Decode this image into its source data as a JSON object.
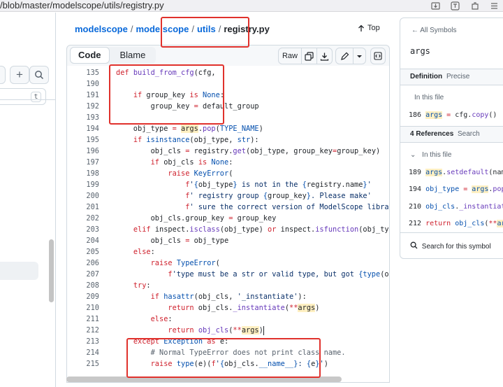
{
  "browser": {
    "url": "/blob/master/modelscope/utils/registry.py",
    "icons": [
      "download-icon",
      "translate-icon",
      "extension-icon",
      "menu-icon"
    ]
  },
  "left": {
    "add_label": "+",
    "kbd_label": "t"
  },
  "breadcrumb": {
    "items": [
      "modelscope",
      "modelscope",
      "utils"
    ],
    "separator": "/",
    "file": "registry.py"
  },
  "top_label": "Top",
  "toolbar": {
    "code_tab": "Code",
    "blame_tab": "Blame",
    "raw_label": "Raw"
  },
  "code_lines": [
    {
      "n": "135",
      "text": "def build_from_cfg(cfg,"
    },
    {
      "n": "190",
      "text": ""
    },
    {
      "n": "191",
      "text": "    if group_key is None:"
    },
    {
      "n": "192",
      "text": "        group_key = default_group"
    },
    {
      "n": "193",
      "text": ""
    },
    {
      "n": "194",
      "text": "    obj_type = args.pop(TYPE_NAME)"
    },
    {
      "n": "195",
      "text": "    if isinstance(obj_type, str):"
    },
    {
      "n": "196",
      "text": "        obj_cls = registry.get(obj_type, group_key=group_key)"
    },
    {
      "n": "197",
      "text": "        if obj_cls is None:"
    },
    {
      "n": "198",
      "text": "            raise KeyError("
    },
    {
      "n": "199",
      "text": "                f'{obj_type} is not in the {registry.name}'"
    },
    {
      "n": "200",
      "text": "                f' registry group {group_key}. Please make'"
    },
    {
      "n": "201",
      "text": "                f' sure the correct version of ModelScope library i"
    },
    {
      "n": "202",
      "text": "        obj_cls.group_key = group_key"
    },
    {
      "n": "203",
      "text": "    elif inspect.isclass(obj_type) or inspect.isfunction(obj_type):"
    },
    {
      "n": "204",
      "text": "        obj_cls = obj_type"
    },
    {
      "n": "205",
      "text": "    else:"
    },
    {
      "n": "206",
      "text": "        raise TypeError("
    },
    {
      "n": "207",
      "text": "            f'type must be a str or valid type, but got {type(obj_t"
    },
    {
      "n": "208",
      "text": "    try:"
    },
    {
      "n": "209",
      "text": "        if hasattr(obj_cls, '_instantiate'):"
    },
    {
      "n": "210",
      "text": "            return obj_cls._instantiate(**args)"
    },
    {
      "n": "211",
      "text": "        else:"
    },
    {
      "n": "212",
      "text": "            return obj_cls(**args)"
    },
    {
      "n": "213",
      "text": "    except Exception as e:"
    },
    {
      "n": "214",
      "text": "        # Normal TypeError does not print class name."
    },
    {
      "n": "215",
      "text": "        raise type(e)(f'{obj_cls.__name__}: {e}')"
    }
  ],
  "symbols": {
    "all_symbols": "All Symbols",
    "symbol": "args",
    "definition_label": "Definition",
    "definition_mode": "Precise",
    "in_this_file": "In this file",
    "definition_row": {
      "n": "186",
      "text": "args = cfg.copy()"
    },
    "references_label": "4 References",
    "references_search": "Search",
    "references_in_file": "In this file",
    "references": [
      {
        "n": "189",
        "text": "args.setdefault(nam"
      },
      {
        "n": "194",
        "text": "obj_type = args.pop"
      },
      {
        "n": "210",
        "text": "obj_cls._instantiat"
      },
      {
        "n": "212",
        "text": "return obj_cls(**ar"
      }
    ],
    "search_label": "Search for this symbol"
  },
  "colors": {
    "link": "#0969da",
    "keyword": "#cf222e",
    "annotation": "#e0312c",
    "highlight": "#fff0c2"
  }
}
